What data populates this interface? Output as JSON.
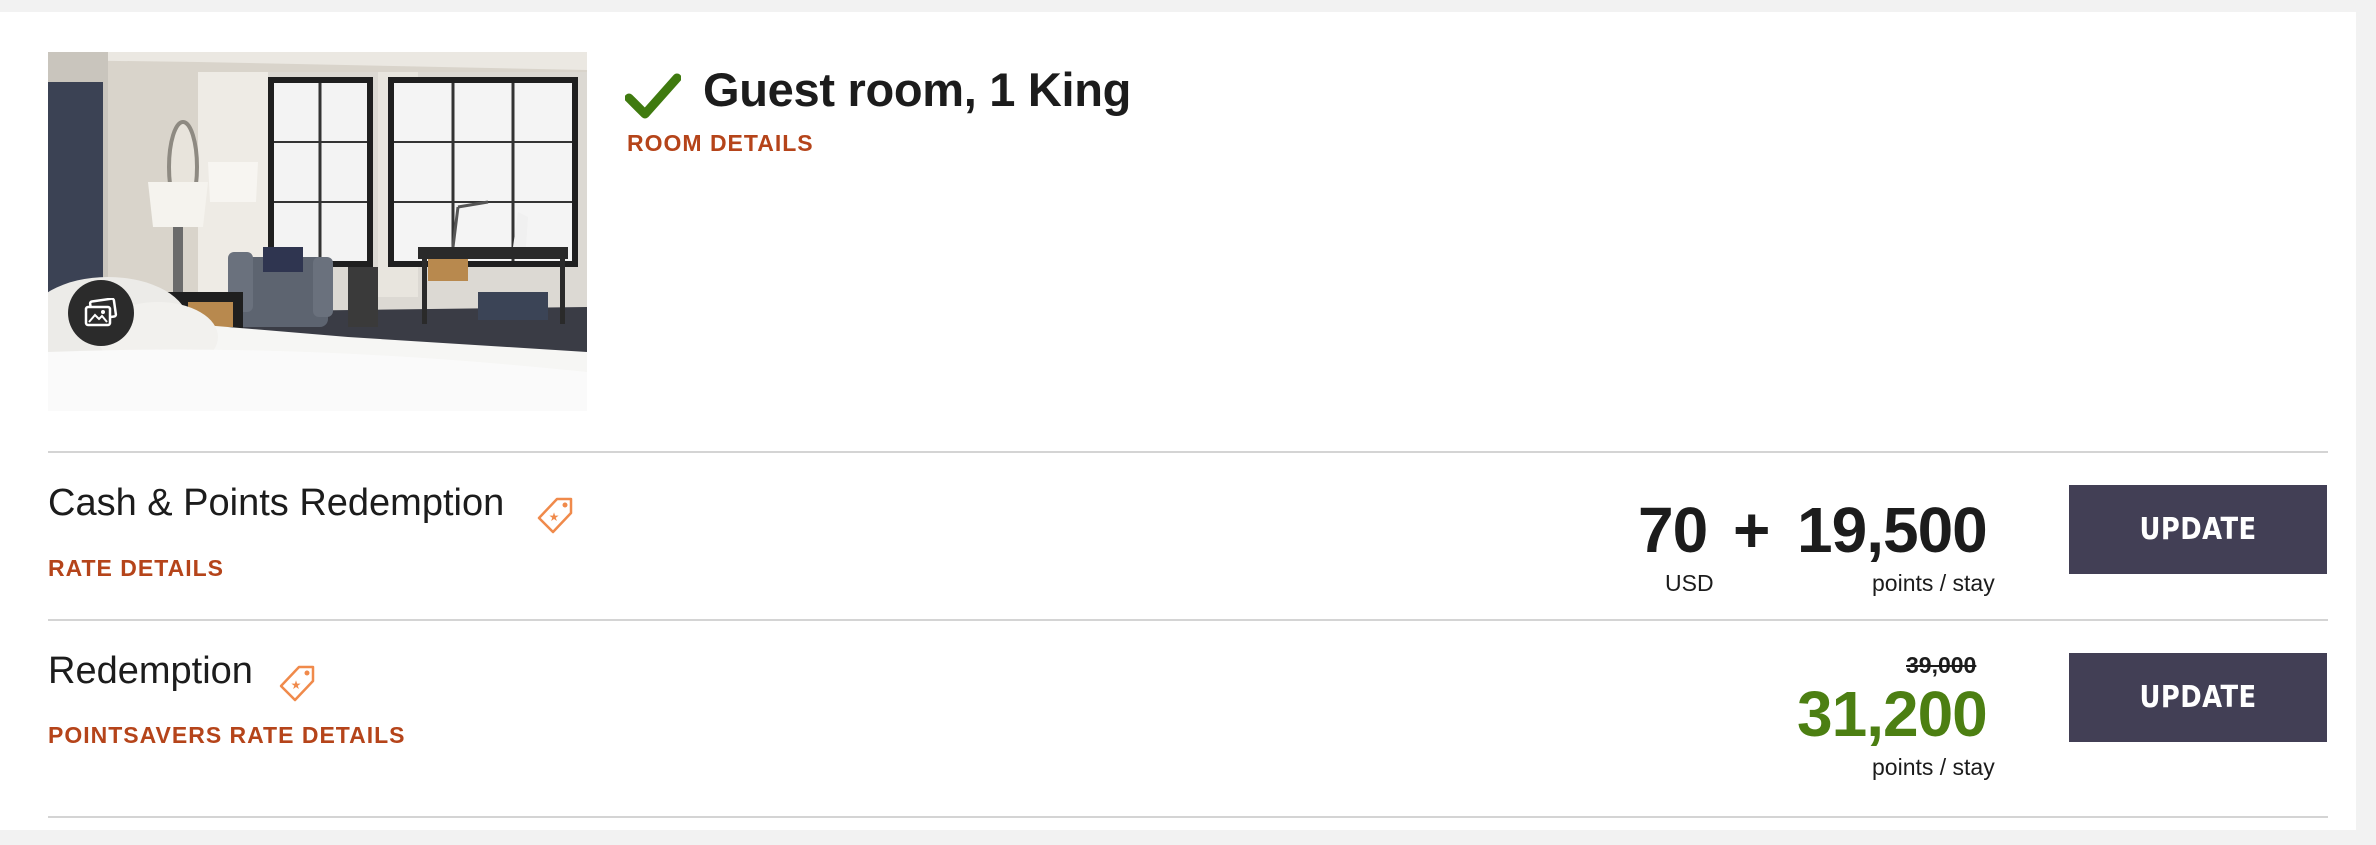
{
  "room": {
    "title": "Guest room, 1 King",
    "details_link": "ROOM DETAILS",
    "photo_icon": "photo-gallery-icon",
    "status_icon": "checkmark-icon"
  },
  "rates": [
    {
      "name": "Cash & Points Redemption",
      "details_link": "RATE DETAILS",
      "cash_amount": "70",
      "plus": "+",
      "currency": "USD",
      "points": "19,500",
      "points_label": "points / stay",
      "button_label": "UPDATE",
      "tag_icon": "offer-tag-icon"
    },
    {
      "name": "Redemption",
      "details_link": "POINTSAVERS RATE DETAILS",
      "original_points": "39,000",
      "points": "31,200",
      "points_label": "points / stay",
      "button_label": "UPDATE",
      "tag_icon": "offer-tag-icon"
    }
  ],
  "colors": {
    "accent_link": "#b5441a",
    "button_bg": "#423f55",
    "discount_green": "#4c7f12",
    "check_green": "#3f7a0f",
    "tag_orange": "#f08a4b"
  }
}
